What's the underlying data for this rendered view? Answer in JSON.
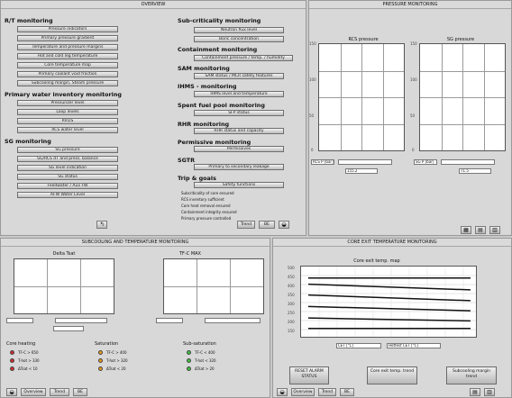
{
  "overview": {
    "title": "OVERVIEW",
    "rt_section": "R/T monitoring",
    "rt_buttons": [
      "Pressure indicators",
      "Primary pressure gradient",
      "Temperature and pressure margins",
      "Hot and cold leg temperature",
      "Core temperature map",
      "Primary coolant void fraction",
      "Subcooling margin, Steam pressure"
    ],
    "pwi_section": "Primary water inventory monitoring",
    "pwi_buttons": [
      "Pressurizer level",
      "Loop levels",
      "RVLIS",
      "RCS water level"
    ],
    "sg_section": "SG monitoring",
    "sg_buttons": [
      "SG pressure",
      "SG/RCS dT and press. balance",
      "SG level indication",
      "SG status",
      "Feedwater / Aux FW",
      "AFW Water Level"
    ],
    "sub_section": "Sub-criticality monitoring",
    "sub_buttons": [
      "Neutron flux level",
      "Boric concentration"
    ],
    "cont_section": "Containment monitoring",
    "cont_buttons": [
      "Containment pressure / temp. / humidity"
    ],
    "sam_section": "SAM monitoring",
    "sam_buttons": [
      "SAM status / MCR safety features"
    ],
    "ihms_section": "IHMS - monitoring",
    "ihms_buttons": [
      "IHMS level and temperature"
    ],
    "sfp_section": "Spent fuel pool monitoring",
    "sfp_buttons": [
      "SFP status"
    ],
    "rhr_section": "RHR monitoring",
    "rhr_buttons": [
      "RHR status and capacity"
    ],
    "perm_section": "Permissive monitoring",
    "perm_buttons": [
      "Permissives"
    ],
    "sgtr_section": "SGTR",
    "sgtr_buttons": [
      "Primary to secondary leakage"
    ],
    "trip_section": "Trip & goals",
    "trip_buttons": [
      "Safety functions"
    ],
    "goals": [
      "Subcriticality of core ensured",
      "RCS inventory sufficient",
      "Core heat removal ensured",
      "Containment integrity ensured",
      "Primary pressure controlled"
    ],
    "bottom_buttons": [
      "Trend",
      "BE"
    ]
  },
  "pressure_panel": {
    "title": "PRESSURE MONITORING",
    "chart1": {
      "title": "RCS pressure"
    },
    "chart2": {
      "title": "SG pressure"
    },
    "yticks": [
      "150",
      "100",
      "50",
      "0"
    ],
    "xticks": [
      "0",
      "50",
      "100"
    ],
    "field1": "RCS P [bar]",
    "field2": "SG P [bar]",
    "value1": "155.2",
    "value2": "71.5",
    "unit": "bar"
  },
  "bottom_left": {
    "title": "SUBCOOLING AND TEMPERATURE MONITORING",
    "chart1": {
      "title": "Delta Tsat"
    },
    "chart2": {
      "title": "TF-C MAX"
    },
    "lamp_groups": [
      {
        "title": "Core heating",
        "color": "#d42a2a",
        "items": [
          "TF-C > 650",
          "T-hot > 330",
          "ΔTsat < 10"
        ]
      },
      {
        "title": "Saturation",
        "color": "#e89a1a",
        "items": [
          "TF-C > 400",
          "T-hot > 320",
          "ΔTsat < 20"
        ]
      },
      {
        "title": "Sub-saturation",
        "color": "#3bc43b",
        "items": [
          "TF-C < 400",
          "T-hot < 320",
          "ΔTsat > 20"
        ]
      }
    ],
    "bottom_buttons": [
      "Overview",
      "Trend",
      "BE"
    ]
  },
  "bottom_right": {
    "title": "CORE EXIT TEMPERATURE MONITORING",
    "chart_title": "Core exit temp. map",
    "yticks": [
      "500",
      "450",
      "400",
      "350",
      "300",
      "250",
      "200",
      "150"
    ],
    "field1": "CET [°C]",
    "field2": "Hottest CET [°C]",
    "big_buttons": [
      "RESET ALARM STATUS",
      "Core exit temp. trend",
      "Subcooling margin trend"
    ],
    "bottom_buttons": [
      "Overview",
      "Trend",
      "BE"
    ]
  }
}
